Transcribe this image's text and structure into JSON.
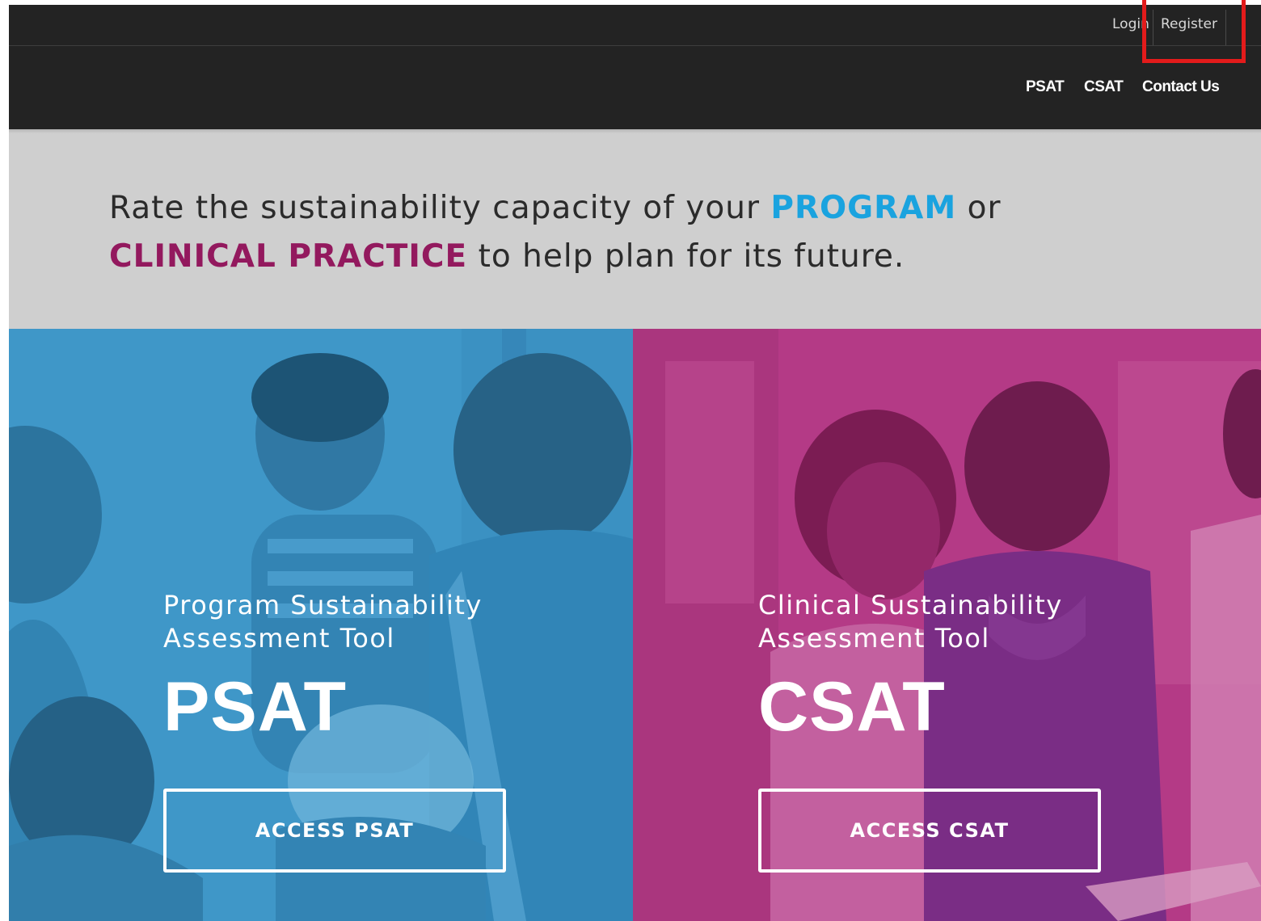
{
  "utility_nav": {
    "login_label": "Login",
    "register_label": "Register"
  },
  "main_nav": {
    "items": [
      {
        "label": "PSAT"
      },
      {
        "label": "CSAT"
      },
      {
        "label": "Contact Us"
      }
    ]
  },
  "tagline": {
    "part1": "Rate the sustainability capacity of your ",
    "program_keyword": "PROGRAM",
    "part2": " or",
    "clinical_keyword": "CLINICAL PRACTICE",
    "part3": " to help plan for its future."
  },
  "psat_panel": {
    "subtitle_line1": "Program Sustainability",
    "subtitle_line2": "Assessment Tool",
    "title": "PSAT",
    "button_label": "ACCESS PSAT"
  },
  "csat_panel": {
    "subtitle_line1": "Clinical Sustainability",
    "subtitle_line2": "Assessment Tool",
    "title": "CSAT",
    "button_label": "ACCESS CSAT"
  },
  "colors": {
    "header_bg": "#232323",
    "tagline_bg": "#cfcfcf",
    "program_blue": "#1aa3df",
    "clinical_magenta": "#93195e",
    "psat_overlay": "#3f97c9",
    "csat_overlay": "#b43a86",
    "highlight_red": "#e31b1b"
  }
}
